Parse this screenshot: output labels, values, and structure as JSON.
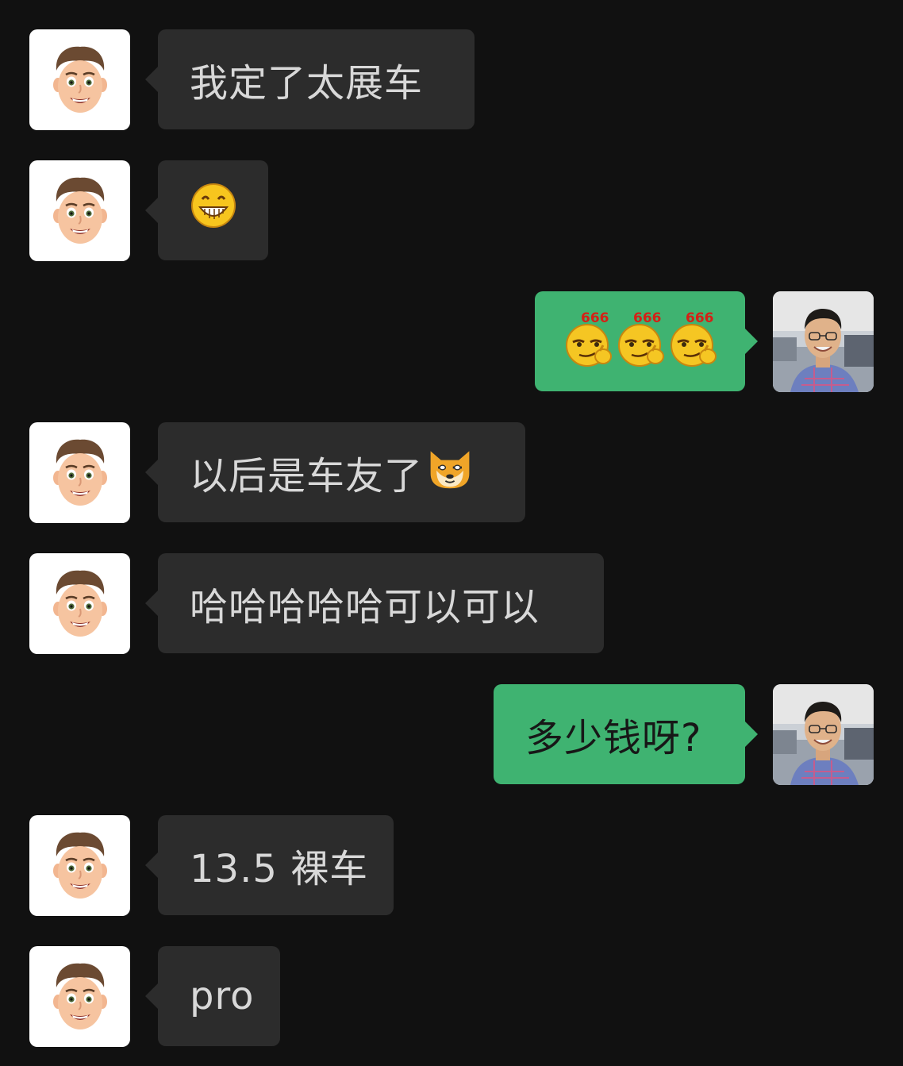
{
  "colors": {
    "background": "#111111",
    "incoming_bubble": "#2c2c2c",
    "incoming_text": "#d8d8d8",
    "outgoing_bubble": "#3fb371",
    "outgoing_text": "#171717"
  },
  "messages": [
    {
      "sender": "contact",
      "avatar": "memoji-avatar",
      "text": "我定了太展车"
    },
    {
      "sender": "contact",
      "avatar": "memoji-avatar",
      "text": "",
      "emoji": "grin-emoji"
    },
    {
      "sender": "me",
      "avatar": "user-photo-avatar",
      "text": "",
      "emoji": "666-emoji x3",
      "emoji_label": "666"
    },
    {
      "sender": "contact",
      "avatar": "memoji-avatar",
      "text": "以后是车友了",
      "emoji": "doge-emoji"
    },
    {
      "sender": "contact",
      "avatar": "memoji-avatar",
      "text": "哈哈哈哈哈可以可以"
    },
    {
      "sender": "me",
      "avatar": "user-photo-avatar",
      "text": "多少钱呀?"
    },
    {
      "sender": "contact",
      "avatar": "memoji-avatar",
      "text": "13.5 裸车"
    },
    {
      "sender": "contact",
      "avatar": "memoji-avatar",
      "text": "pro"
    }
  ]
}
